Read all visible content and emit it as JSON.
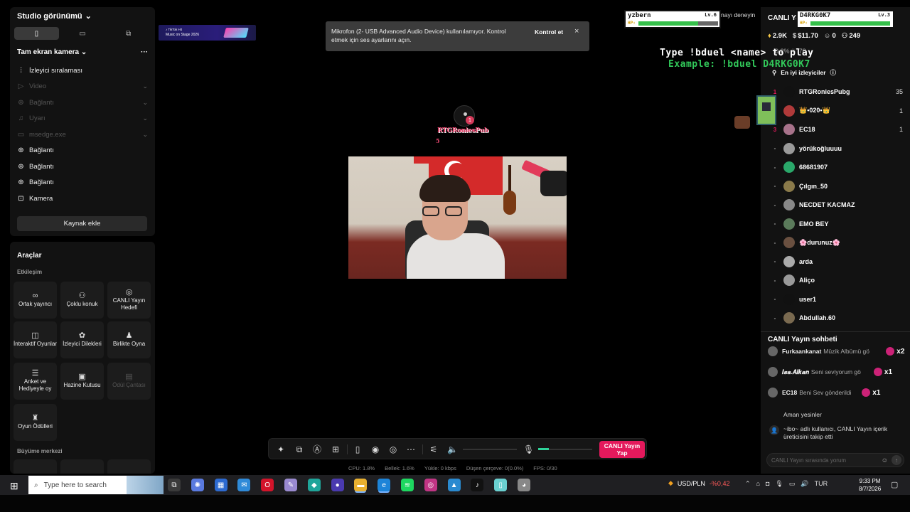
{
  "colors": {
    "accent": "#e4195c",
    "panel": "#121212",
    "live_green": "#2fd39a",
    "hp_green": "#35c04a",
    "duel_green": "#32c95a",
    "overlay_pink": "#f04872"
  },
  "studio": {
    "title": "Studio görünümü",
    "layout_icons": [
      "phone-portrait-icon",
      "monitor-landscape-icon",
      "layout-square-icon"
    ],
    "camera_section": "Tam ekran kamera",
    "more": "···",
    "sources": [
      {
        "label": "İzleyici sıralaması",
        "icon": "leaderboard-icon",
        "dim": false,
        "chevron": false
      },
      {
        "label": "Video",
        "icon": "play-circle-icon",
        "dim": true,
        "chevron": true
      },
      {
        "label": "Bağlantı",
        "icon": "globe-icon",
        "dim": true,
        "chevron": true
      },
      {
        "label": "Uyarı",
        "icon": "bell-icon",
        "dim": true,
        "chevron": true
      },
      {
        "label": "msedge.exe",
        "icon": "window-icon",
        "dim": true,
        "chevron": true
      },
      {
        "label": "Bağlantı",
        "icon": "globe-icon",
        "dim": false,
        "chevron": false
      },
      {
        "label": "Bağlantı",
        "icon": "globe-icon",
        "dim": false,
        "chevron": false
      },
      {
        "label": "Bağlantı",
        "icon": "globe-icon",
        "dim": false,
        "chevron": false
      },
      {
        "label": "Kamera",
        "icon": "camera-icon",
        "dim": false,
        "chevron": false
      }
    ],
    "add_source": "Kaynak ekle"
  },
  "tools": {
    "title": "Araçlar",
    "interaction_label": "Etkileşim",
    "growth_label": "Büyüme merkezi",
    "items": [
      {
        "label": "Ortak yayıncı",
        "icon": "link-icon",
        "disabled": false
      },
      {
        "label": "Çoklu konuk",
        "icon": "guests-icon",
        "disabled": false
      },
      {
        "label": "CANLI Yayın Hedefi",
        "icon": "target-icon",
        "disabled": false
      },
      {
        "label": "İnteraktif Oyunlar",
        "icon": "gamepad-icon",
        "disabled": false
      },
      {
        "label": "İzleyici Dilekleri",
        "icon": "gift-icon",
        "disabled": false
      },
      {
        "label": "Birlikte Oyna",
        "icon": "play-together-icon",
        "disabled": false
      },
      {
        "label": "Anket ve Hediyeyle oy",
        "icon": "poll-icon",
        "disabled": false
      },
      {
        "label": "Hazine Kutusu",
        "icon": "treasure-icon",
        "disabled": false
      },
      {
        "label": "Ödül Çantası",
        "icon": "bag-icon",
        "disabled": true
      },
      {
        "label": "Oyun Ödülleri",
        "icon": "trophy-icon",
        "disabled": false
      }
    ],
    "growth_icons": [
      "heart-icon",
      "gift-box-icon",
      "badge-icon"
    ]
  },
  "banner": {
    "line1": "♪ TikTok Hit",
    "line2": "Music on Stage 2026"
  },
  "notification": {
    "message": "Mikrofon (2- USB Advanced Audio Device) kullanılamıyor. Kontrol etmek için ses ayarlarını açın.",
    "button": "Kontrol et",
    "close": "×"
  },
  "preview": {
    "overlay_user": "RTGRoniesPub",
    "overlay_count": "5",
    "gift_badge": "1"
  },
  "controls": {
    "icons": [
      "magic-wand-icon",
      "layers-icon",
      "ai-effects-icon",
      "add-screen-icon",
      "phone-icon",
      "record-icon",
      "stream-target-icon",
      "more-icon",
      "sliders-icon",
      "speaker-icon",
      "mic-icon"
    ],
    "mic_level": 0.2,
    "live_button": "CANLI Yayın Yap"
  },
  "stats": {
    "cpu": "CPU: 1.8%",
    "memory": "Bellek: 1.6%",
    "upload": "Yükle: 0 kbps",
    "dropped": "Düşen çerçeve: 0(0.0%)",
    "fps": "FPS: 0/30"
  },
  "game": {
    "player1": {
      "name": "yzbern",
      "level": "Lv.6",
      "hp_label": "HP:",
      "hp": 0.75
    },
    "player2": {
      "name": "D4RKG0K7",
      "level": "Lv.3",
      "hp_label": "HP:",
      "hp": 1.0
    },
    "line1": "Type !bduel <name> to play",
    "line2": "Example: !bduel D4RKG0K7",
    "try_hint": "nayı deneyin"
  },
  "right": {
    "title": "CANLI Ya",
    "stats": {
      "diamonds": "2.9K",
      "earnings": "$11.70",
      "followers": "0",
      "viewers": "249"
    },
    "stats2": "0.2%  ♡ 78",
    "viewers_tab": "En iyi izleyiciler",
    "viewers": [
      {
        "rank": "1",
        "name": "RTGRoniesPubg",
        "count": "35",
        "color": "#111"
      },
      {
        "rank": "2",
        "name": "👑•020•👑",
        "count": "1",
        "color": "#b03a3a"
      },
      {
        "rank": "3",
        "name": "EC18",
        "count": "1",
        "color": "#a7728a"
      },
      {
        "rank": "-",
        "name": "yörükoğluuuu",
        "count": "",
        "color": "#9a9a9a"
      },
      {
        "rank": "-",
        "name": "68681907",
        "count": "",
        "color": "#2aa86a"
      },
      {
        "rank": "-",
        "name": "Çılgın_50",
        "count": "",
        "color": "#8a7a4a"
      },
      {
        "rank": "-",
        "name": "NECDET KACMAZ",
        "count": "",
        "color": "#888"
      },
      {
        "rank": "-",
        "name": "EMO BEY",
        "count": "",
        "color": "#5a7a5a"
      },
      {
        "rank": "-",
        "name": "🌸durunuz🌸",
        "count": "",
        "color": "#6a5040"
      },
      {
        "rank": "-",
        "name": "arda",
        "count": "",
        "color": "#aaa"
      },
      {
        "rank": "-",
        "name": "Aliço",
        "count": "",
        "color": "#999"
      },
      {
        "rank": "-",
        "name": "user1",
        "count": "",
        "color": "#111"
      },
      {
        "rank": "-",
        "name": "Abdullah.60",
        "count": "",
        "color": "#7a6a50"
      }
    ],
    "chat_title": "CANLI Yayın sohbeti",
    "chat": [
      {
        "user": "Furkaankanat",
        "text": "Müzik Albümü gö",
        "mult": "x2"
      },
      {
        "user": "𝑰𝒔𝒂.𝑨𝒍𝒌𝒂𝒏",
        "text": "Seni seviyorum gö",
        "mult": "x1"
      },
      {
        "user": "EC18",
        "text": "Beni Sev gönderildi",
        "mult": "x1"
      }
    ],
    "chat_name": "Aman yesinler",
    "follow_text": "~ibo~ adlı kullanıcı, CANLI Yayın içerik üreticisini takip etti",
    "input_placeholder": "CANLI Yayın sırasında yorum"
  },
  "taskbar": {
    "search_placeholder": "Type here to search",
    "apps": [
      "task-view-icon",
      "copilot-icon",
      "store-icon",
      "mail-icon",
      "opera-icon",
      "chat-icon",
      "app-icon",
      "obs-icon",
      "file-explorer-icon",
      "edge-icon",
      "spotify-icon",
      "instagram-icon",
      "photos-icon",
      "tiktok-icon",
      "notes-icon",
      "chrome-icon"
    ],
    "fx_pair": "USD/PLN",
    "fx_change": "-%0,42",
    "lang": "TUR",
    "time": "9:33 PM",
    "date": "8/7/2026"
  }
}
